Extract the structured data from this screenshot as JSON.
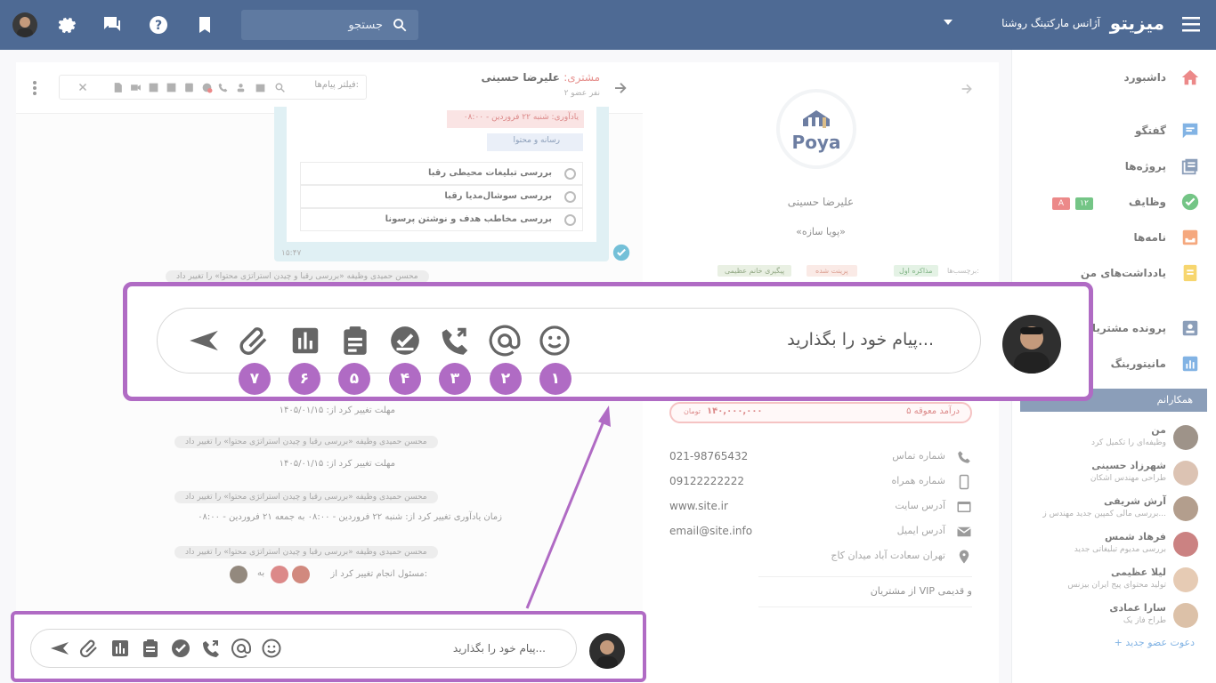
{
  "topbar": {
    "brand": "میزیتو",
    "org": "آژانس مارکتینگ روشنا",
    "search_placeholder": "جستجو"
  },
  "sidebar": {
    "items": [
      {
        "label": "داشبورد"
      },
      {
        "label": "گفتگو"
      },
      {
        "label": "پروژه‌ها"
      },
      {
        "label": "وظایف",
        "badge_green": "۱۲",
        "badge_red": "A"
      },
      {
        "label": "نامه‌ها"
      },
      {
        "label": "یادداشت‌های من"
      },
      {
        "label": "پرونده مشتریان"
      },
      {
        "label": "مانیتورینگ"
      }
    ],
    "team_header": "همکارانم",
    "members": [
      {
        "name": "من",
        "role": "وظیفه‌ای را تکمیل کرد"
      },
      {
        "name": "شهرزاد حسینی",
        "role": "طراحی مهندس اشکان"
      },
      {
        "name": "آرش شریفی",
        "role": "بررسی مالی کمپین جدید مهندس ز..."
      },
      {
        "name": "فرهاد شمس",
        "role": "بررسی مدیوم تبلیغاتی جدید"
      },
      {
        "name": "لیلا عظیمی",
        "role": "تولید محتوای پیج ایران بیزنس"
      },
      {
        "name": "سارا عمادی",
        "role": "طراح فاز یک"
      }
    ],
    "invite": "+ دعوت عضو جدید"
  },
  "customer": {
    "logo_text": "Poya",
    "name": "علیرضا حسینی",
    "company": "«پویا سازه»",
    "tags_label": "برچسب‌ها:",
    "tags": [
      "مذاکره اول",
      "پرینت شده",
      "پیگیری خانم عظیمی"
    ],
    "revenue_label": "۵ درآمد معوقه",
    "revenue_value": "۱۴۰,۰۰۰,۰۰۰",
    "revenue_unit": "تومان",
    "contacts": [
      {
        "key": "شماره تماس",
        "value": "021-98765432"
      },
      {
        "key": "شماره همراه",
        "value": "09122222222"
      },
      {
        "key": "آدرس سایت",
        "value": "www.site.ir"
      },
      {
        "key": "آدرس ایمیل",
        "value": "email@site.info"
      },
      {
        "key": "تهران سعادت آباد میدان کاج",
        "value": ""
      }
    ],
    "note": "از مشتریان VIP و قدیمی"
  },
  "chat": {
    "title_prefix": "مشتری:",
    "title_name": "علیرضا حسینی",
    "members_count": "۲ نفر عضو",
    "filter_placeholder": "فیلتر پیام‌ها:",
    "reminder": "یادآوری: شنبه ۲۲ فروردین - ۰۸:۰۰",
    "media_label": "رسانه و محتوا",
    "tasks": [
      "بررسی تبلیغات محیطی رقبا",
      "بررسی سوشال‌مدیا رقبا",
      "بررسی مخاطب هدف و نوشتن پرسونا"
    ],
    "card_time": "۱۵:۴۷",
    "logs": [
      {
        "pill": "محسن حمیدی وظیفه «بررسی رقبا و چیدن استراتژی محتوا» را تغییر داد",
        "text": "مهلت تغییر کرد از: ۱۴۰۵/۰۱/۱۵"
      },
      {
        "pill": "محسن حمیدی وظیفه «بررسی رقبا و چیدن استراتژی محتوا» را تغییر داد",
        "text": "مهلت تغییر کرد از: ۱۴۰۵/۰۱/۱۵"
      },
      {
        "pill": "محسن حمیدی وظیفه «بررسی رقبا و چیدن استراتژی محتوا» را تغییر داد",
        "text": "زمان یادآوری تغییر کرد از: شنبه ۲۲ فروردین - ۰۸:۰۰ به جمعه ۲۱ فروردین - ۰۸:۰۰"
      },
      {
        "pill": "محسن حمیدی وظیفه «بررسی رقبا و چیدن استراتژی محتوا» را تغییر داد",
        "text": "مسئول انجام تغییر کرد از:"
      }
    ],
    "to_word": "به",
    "composer_placeholder": "پیام خود را بگذارید..."
  },
  "zoom": {
    "placeholder": "پیام خود را بگذارید...",
    "numbers": [
      "۱",
      "۲",
      "۳",
      "۴",
      "۵",
      "۶",
      "۷"
    ]
  },
  "colors": {
    "topbar": "#4e6a94",
    "accent": "#b06bc4",
    "icon_gray": "#666666"
  }
}
